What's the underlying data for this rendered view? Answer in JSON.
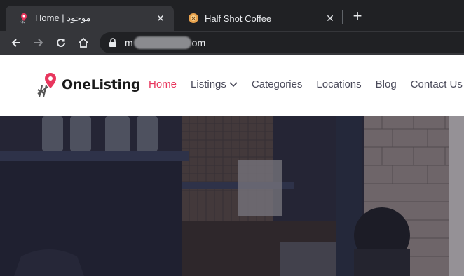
{
  "browser": {
    "tabs": [
      {
        "title": "Home | موجود",
        "active": true
      },
      {
        "title": "Half Shot Coffee",
        "active": false
      }
    ],
    "address": {
      "prefix": "m",
      "suffix": "om"
    }
  },
  "site": {
    "logo_text": "OneListing",
    "nav": [
      {
        "label": "Home",
        "active": true
      },
      {
        "label": "Listings",
        "dropdown": true
      },
      {
        "label": "Categories"
      },
      {
        "label": "Locations"
      },
      {
        "label": "Blog"
      },
      {
        "label": "Contact Us"
      }
    ],
    "accent": "#e8365d"
  }
}
